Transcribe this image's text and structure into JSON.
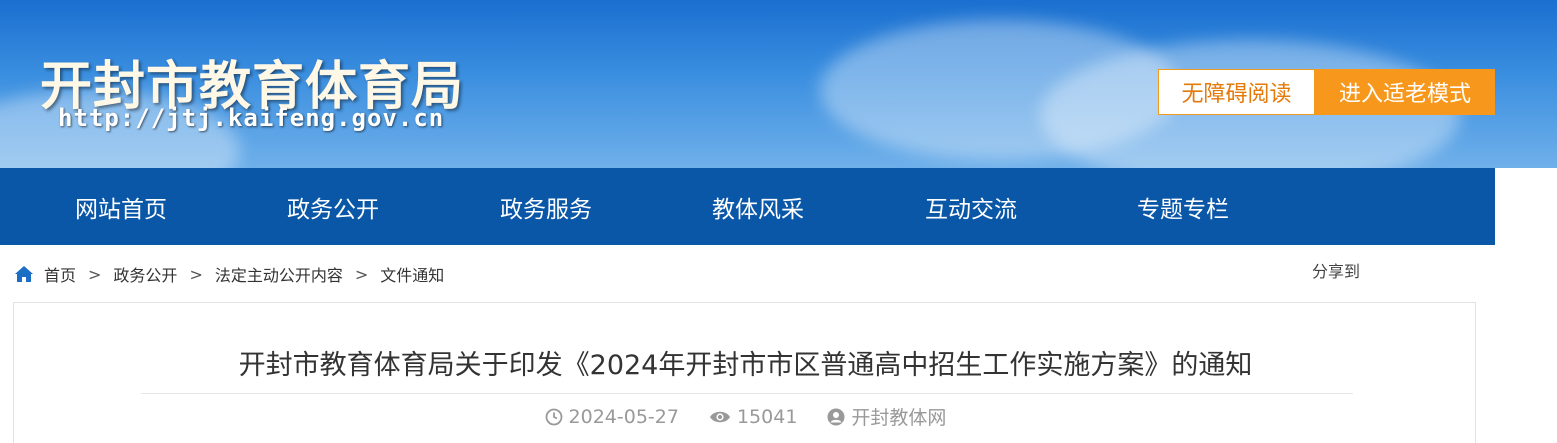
{
  "header": {
    "site_title": "开封市教育体育局",
    "site_url": "http://jtj.kaifeng.gov.cn",
    "accessibility_button": "无障碍阅读",
    "elder_mode_button": "进入适老模式"
  },
  "nav": {
    "items": [
      "网站首页",
      "政务公开",
      "政务服务",
      "教体风采",
      "互动交流",
      "专题专栏"
    ]
  },
  "breadcrumb": {
    "items": [
      "首页",
      "政务公开",
      "法定主动公开内容",
      "文件通知"
    ],
    "separator": ">"
  },
  "share": {
    "label": "分享到"
  },
  "article": {
    "title": "开封市教育体育局关于印发《2024年开封市市区普通高中招生工作实施方案》的通知",
    "date": "2024-05-27",
    "views": "15041",
    "source": "开封教体网"
  },
  "colors": {
    "nav_bg": "#0a57a8",
    "accent_orange": "#f7981c"
  }
}
